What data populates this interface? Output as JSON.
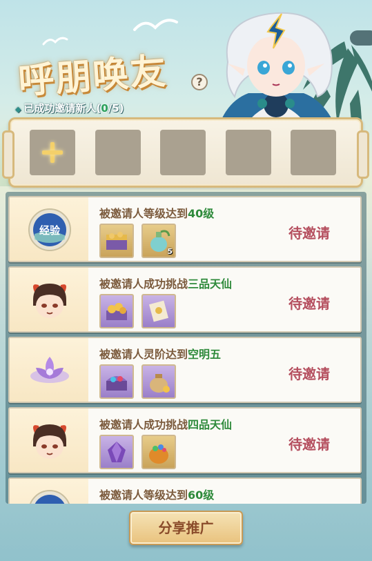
{
  "header": {
    "title": "呼朋唤友",
    "help_icon": "?",
    "invite_label": "已成功邀请新人",
    "invite_open": "(",
    "invite_done": "0",
    "invite_sep": "/",
    "invite_total": "5",
    "invite_close": ")",
    "progress_fraction": 0.0
  },
  "slots": {
    "count": 5,
    "add_icon": "plus-icon"
  },
  "tasks": [
    {
      "cond_prefix": "被邀请人等级达到",
      "cond_highlight": "40级",
      "status": "待邀请",
      "icon": "exp-medal-icon",
      "icon_text": "经验",
      "rewards": [
        {
          "icon": "treasure-chest-icon",
          "style": "gold",
          "qty": ""
        },
        {
          "icon": "potion-bottle-icon",
          "style": "gold",
          "qty": "5"
        }
      ]
    },
    {
      "cond_prefix": "被邀请人成功挑战",
      "cond_highlight": "三品天仙",
      "status": "待邀请",
      "icon": "horned-boy-avatar-icon",
      "rewards": [
        {
          "icon": "gold-chest-icon",
          "style": "purple",
          "qty": ""
        },
        {
          "icon": "scroll-ticket-icon",
          "style": "purple",
          "qty": ""
        }
      ]
    },
    {
      "cond_prefix": "被邀请人灵阶达到",
      "cond_highlight": "空明五",
      "status": "待邀请",
      "icon": "purple-lotus-icon",
      "rewards": [
        {
          "icon": "jewel-chest-icon",
          "style": "purple",
          "qty": ""
        },
        {
          "icon": "coin-bag-icon",
          "style": "purple",
          "qty": ""
        }
      ]
    },
    {
      "cond_prefix": "被邀请人成功挑战",
      "cond_highlight": "四品天仙",
      "status": "待邀请",
      "icon": "horned-boy-avatar-icon",
      "rewards": [
        {
          "icon": "purple-crystal-icon",
          "style": "purple",
          "qty": ""
        },
        {
          "icon": "gem-sack-icon",
          "style": "gold",
          "qty": ""
        }
      ]
    },
    {
      "cond_prefix": "被邀请人等级达到",
      "cond_highlight": "60级",
      "status": "",
      "icon": "exp-medal-icon",
      "rewards": []
    }
  ],
  "share_button": "分享推广",
  "colors": {
    "highlight_green": "#2e8a3b",
    "status_red": "#b54f5f",
    "condition_brown": "#7b5a3c"
  }
}
